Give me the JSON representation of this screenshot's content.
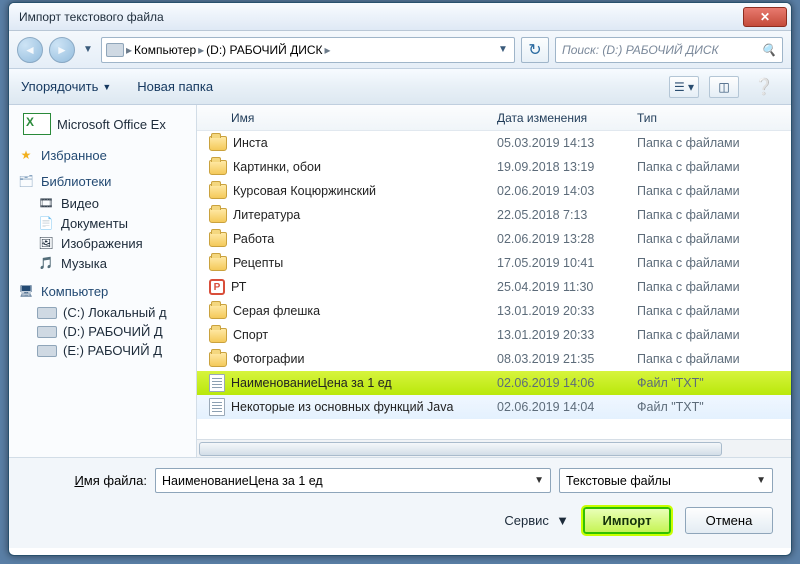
{
  "window": {
    "title": "Импорт текстового файла"
  },
  "nav": {
    "crumbs": [
      "Компьютер",
      "(D:) РАБОЧИЙ ДИСК"
    ],
    "search_placeholder": "Поиск: (D:) РАБОЧИЙ ДИСК"
  },
  "toolbar": {
    "organize": "Упорядочить",
    "new_folder": "Новая папка"
  },
  "sidebar": {
    "office": "Microsoft Office Ex",
    "favorites": "Избранное",
    "libs_header": "Библиотеки",
    "libs": [
      "Видео",
      "Документы",
      "Изображения",
      "Музыка"
    ],
    "comp_header": "Компьютер",
    "drives": [
      "(C:) Локальный д",
      "(D:) РАБОЧИЙ Д",
      "(E:) РАБОЧИЙ Д"
    ]
  },
  "columns": {
    "name": "Имя",
    "date": "Дата изменения",
    "type": "Тип"
  },
  "rows": [
    {
      "icon": "folder",
      "name": "Инста",
      "date": "05.03.2019 14:13",
      "type": "Папка с файлами"
    },
    {
      "icon": "folder",
      "name": "Картинки, обои",
      "date": "19.09.2018 13:19",
      "type": "Папка с файлами"
    },
    {
      "icon": "folder",
      "name": "Курсовая Коцюржинский",
      "date": "02.06.2019 14:03",
      "type": "Папка с файлами"
    },
    {
      "icon": "folder",
      "name": "Литература",
      "date": "22.05.2018 7:13",
      "type": "Папка с файлами"
    },
    {
      "icon": "folder",
      "name": "Работа",
      "date": "02.06.2019 13:28",
      "type": "Папка с файлами"
    },
    {
      "icon": "folder",
      "name": "Рецепты",
      "date": "17.05.2019 10:41",
      "type": "Папка с файлами"
    },
    {
      "icon": "pt",
      "name": "РТ",
      "date": "25.04.2019 11:30",
      "type": "Папка с файлами"
    },
    {
      "icon": "folder",
      "name": "Серая флешка",
      "date": "13.01.2019 20:33",
      "type": "Папка с файлами"
    },
    {
      "icon": "folder",
      "name": "Спорт",
      "date": "13.01.2019 20:33",
      "type": "Папка с файлами"
    },
    {
      "icon": "folder",
      "name": "Фотографии",
      "date": "08.03.2019 21:35",
      "type": "Папка с файлами"
    },
    {
      "icon": "txt",
      "name": "НаименованиеЦена за 1 ед",
      "date": "02.06.2019 14:06",
      "type": "Файл \"TXT\"",
      "selected": true
    },
    {
      "icon": "txt",
      "name": "Некоторые из основных функций Java",
      "date": "02.06.2019 14:04",
      "type": "Файл \"TXT\"",
      "hover": true
    }
  ],
  "footer": {
    "filename_label_pre": "И",
    "filename_label_rest": "мя файла:",
    "filename_value": "НаименованиеЦена за 1 ед",
    "filter": "Текстовые файлы",
    "tools": "Сервис",
    "import": "Импорт",
    "cancel": "Отмена"
  }
}
